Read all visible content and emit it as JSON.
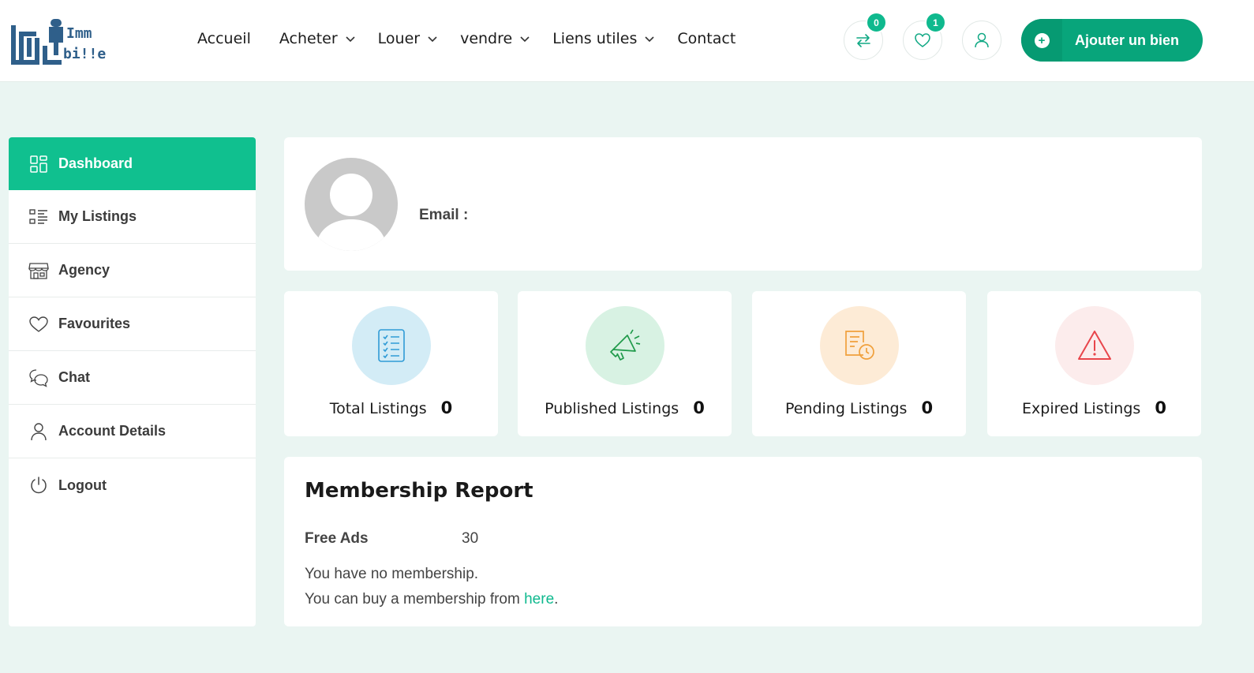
{
  "logo": {
    "text_top": "Imm",
    "text_bottom": "bi!!er",
    "alt": "Immobilier logo"
  },
  "nav": {
    "items": [
      {
        "label": "Accueil",
        "has_dropdown": false
      },
      {
        "label": "Acheter",
        "has_dropdown": true
      },
      {
        "label": "Louer",
        "has_dropdown": true
      },
      {
        "label": "vendre",
        "has_dropdown": true
      },
      {
        "label": "Liens utiles",
        "has_dropdown": true
      },
      {
        "label": "Contact",
        "has_dropdown": false
      }
    ]
  },
  "header_actions": {
    "compare": {
      "icon": "compare-arrows-icon",
      "count": "0"
    },
    "wishlist": {
      "icon": "heart-icon",
      "count": "1"
    },
    "account": {
      "icon": "user-icon"
    },
    "add_property": {
      "label": "Ajouter un bien",
      "icon": "plus-icon"
    }
  },
  "sidebar": {
    "items": [
      {
        "label": "Dashboard",
        "icon": "dashboard-grid-icon",
        "active": true
      },
      {
        "label": "My Listings",
        "icon": "list-icon",
        "active": false
      },
      {
        "label": "Agency",
        "icon": "store-icon",
        "active": false
      },
      {
        "label": "Favourites",
        "icon": "heart-icon",
        "active": false
      },
      {
        "label": "Chat",
        "icon": "chat-bubbles-icon",
        "active": false
      },
      {
        "label": "Account Details",
        "icon": "user-icon",
        "active": false
      },
      {
        "label": "Logout",
        "icon": "power-icon",
        "active": false
      }
    ]
  },
  "profile": {
    "email_label": "Email :",
    "email_value": ""
  },
  "stats": [
    {
      "label": "Total Listings",
      "value": "0",
      "icon": "checklist-icon",
      "bubble_color": "#d3ecf6",
      "icon_color": "#2f9bd6"
    },
    {
      "label": "Published Listings",
      "value": "0",
      "icon": "megaphone-icon",
      "bubble_color": "#d8f2e3",
      "icon_color": "#1f9a4a"
    },
    {
      "label": "Pending Listings",
      "value": "0",
      "icon": "document-clock-icon",
      "bubble_color": "#fdebd6",
      "icon_color": "#f0a03c"
    },
    {
      "label": "Expired Listings",
      "value": "0",
      "icon": "warning-triangle-icon",
      "bubble_color": "#fcecec",
      "icon_color": "#e8454b"
    }
  ],
  "membership": {
    "title": "Membership Report",
    "free_ads_label": "Free Ads",
    "free_ads_value": "30",
    "no_membership_text": "You have no membership.",
    "buy_text": "You can buy a membership from ",
    "buy_link": "here",
    "buy_suffix": "."
  },
  "colors": {
    "accent": "#10c08f",
    "button": "#08a57b",
    "background": "#eaf5f2"
  }
}
